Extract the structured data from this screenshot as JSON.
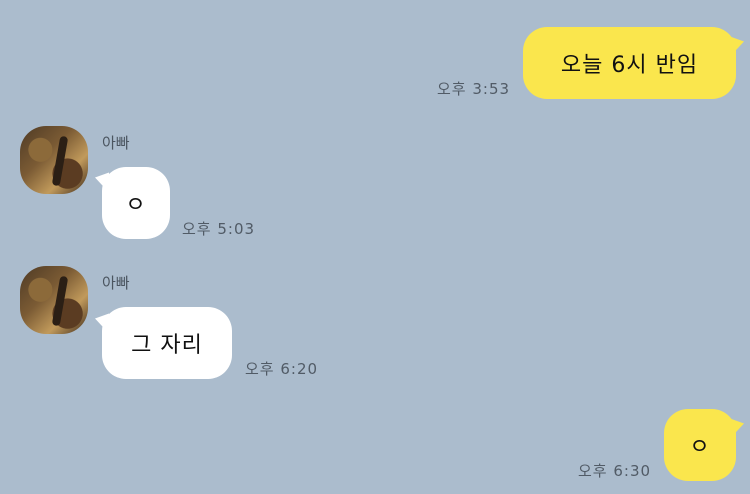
{
  "messages": [
    {
      "from": "me",
      "text": "오늘 6시 반임",
      "time": "오후 3:53"
    },
    {
      "from": "other",
      "sender": "아빠",
      "text": "ㅇ",
      "time": "오후 5:03"
    },
    {
      "from": "other",
      "sender": "아빠",
      "text": "그 자리",
      "time": "오후 6:20"
    },
    {
      "from": "me",
      "text": "ㅇ",
      "time": "오후 6:30"
    }
  ],
  "colors": {
    "background": "#abbccd",
    "my_bubble": "#fae64d",
    "other_bubble": "#ffffff"
  }
}
